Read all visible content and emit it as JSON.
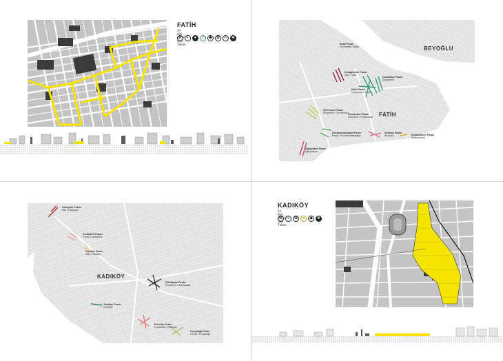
{
  "colors": {
    "accent": "#f4e400",
    "block": "#bdbdbd",
    "street": "#ffffff",
    "map_bg": "#c9c9c9",
    "water": "#ffffff",
    "map_base": "#e0e0e0"
  },
  "fatih_panel": {
    "title": "FATİH",
    "subtitle": "30 000 m² / 6 000 Tables",
    "icons": [
      "tool-icon",
      "cart-icon",
      "pot-icon",
      "ring-icon",
      "fish-icon",
      "fruit-icon",
      "loop-icon",
      "leaf-icon"
    ]
  },
  "overview_fatih": {
    "districts": [
      "BEYOĞLU",
      "FATİH"
    ],
    "bazaars": [
      {
        "name": "Balat Pazarı",
        "detail": "Cumartesi / Balat"
      },
      {
        "name": "Karagümrük Pazarı",
        "detail": "Salı / Fatih"
      },
      {
        "name": "Fatih Pazarı",
        "detail": "Çarşamba / Fatih"
      },
      {
        "name": "Çarşamba Pazarı",
        "detail": "Çarşamba"
      },
      {
        "name": "Şehremini Pazarı",
        "detail": "Perşembe / Şehremini"
      },
      {
        "name": "Fındıkzade Pazarı",
        "detail": "Pazartesi / Fındıkzade"
      },
      {
        "name": "Kocamustafapaşa Pazarı",
        "detail": "Pazar / Kocamustafapaşa"
      },
      {
        "name": "Aksaray Pazarı",
        "detail": "Aksaray"
      },
      {
        "name": "Sultanahmet Pazarı",
        "detail": "Sultanahmet"
      },
      {
        "name": "Ağaçkakan Pazarı",
        "detail": "Ağaçkakan"
      }
    ]
  },
  "overview_kadikoy": {
    "district": "KADIKÖY",
    "bazaars": [
      {
        "name": "Koşuyolu Pazarı",
        "detail": "Salı / Koşuyolu"
      },
      {
        "name": "Acıbadem Pazarı",
        "detail": "Cuma / Acıbadem"
      },
      {
        "name": "Kadıköy Pazarı",
        "detail": "Salı / Kadıköy"
      },
      {
        "name": "Zühtüpaşa Pazarı",
        "detail": "Perşembe / Zühtüpaşa"
      },
      {
        "name": "Göztepe Pazarı",
        "detail": "Göztepe"
      },
      {
        "name": "Erenköy Pazarı",
        "detail": "Cumartesi / Erenköy"
      },
      {
        "name": "Kozyatağı Pazarı",
        "detail": "Cuma / Kozyatağı"
      }
    ]
  },
  "kadikoy_panel": {
    "title": "KADIKÖY",
    "subtitle": "48 000 m² / 6 300 Tables",
    "icons": [
      "tool-icon",
      "cart-icon",
      "pot-icon",
      "ring-icon",
      "fish-icon",
      "fruit-icon"
    ]
  }
}
